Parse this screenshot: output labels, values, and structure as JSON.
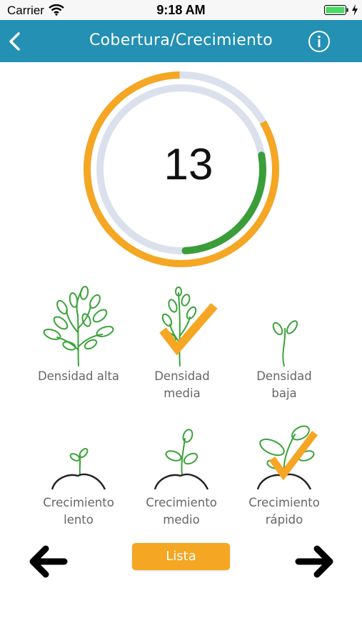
{
  "status_bar": {
    "carrier": "Carrier",
    "time": "9:18 AM"
  },
  "header": {
    "title": "Cobertura/Crecimiento"
  },
  "gauge": {
    "value": "13",
    "outer_fraction": 0.83,
    "inner_fraction": 0.27
  },
  "options": [
    {
      "label": "Densidad alta",
      "selected": false
    },
    {
      "label": "Densidad\nmedia",
      "selected": true
    },
    {
      "label": "Densidad\nbaja",
      "selected": false
    },
    {
      "label": "Crecimiento\nlento",
      "selected": false
    },
    {
      "label": "Crecimiento\nmedio",
      "selected": false
    },
    {
      "label": "Crecimiento\nrápido",
      "selected": true
    }
  ],
  "list_button": {
    "label": "Lista"
  },
  "colors": {
    "nav": "#2390b4",
    "orange": "#f5a623",
    "green": "#3a9d3a",
    "ring_bg": "#dbe1ec",
    "plant": "#3aa33a"
  },
  "icons": [
    "back-chevron-icon",
    "info-icon",
    "plant-icon",
    "checkmark-icon",
    "arrow-left-icon",
    "arrow-right-icon"
  ]
}
